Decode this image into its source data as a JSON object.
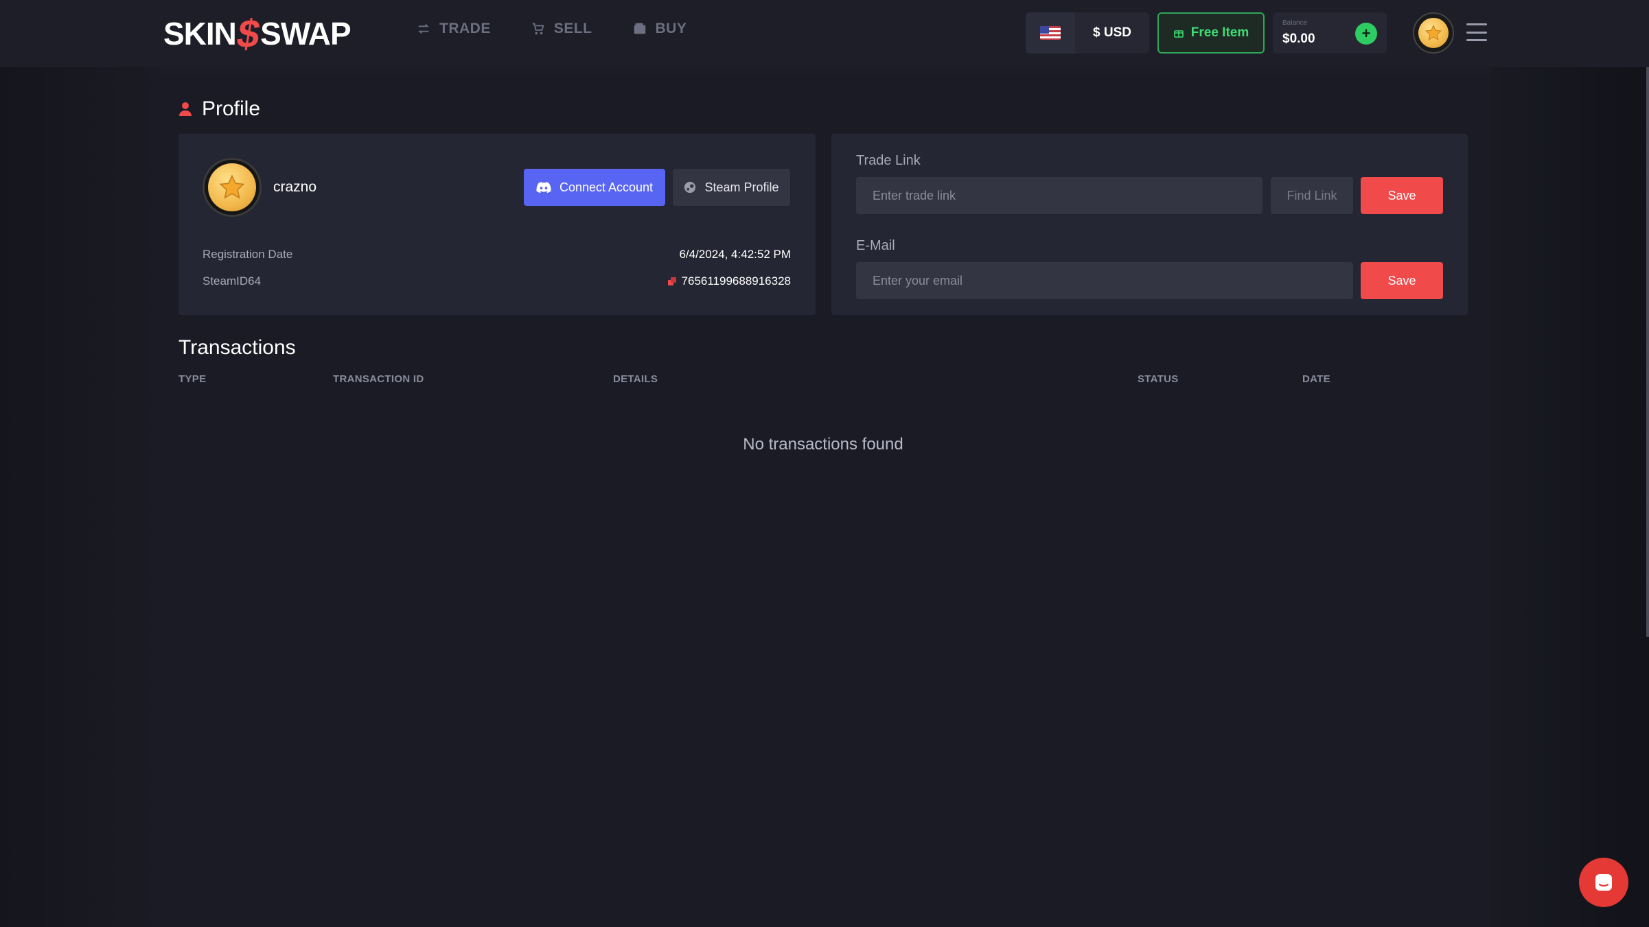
{
  "header": {
    "logo_left": "SKIN",
    "logo_mark": "$",
    "logo_right": "SWAP",
    "nav": [
      {
        "label": "TRADE",
        "icon": "trade-arrows-icon"
      },
      {
        "label": "SELL",
        "icon": "cart-icon"
      },
      {
        "label": "BUY",
        "icon": "wallet-icon"
      }
    ],
    "currency": "$ USD",
    "flag_icon": "us-flag-icon",
    "free_item": "Free Item",
    "balance_caption": "Balance",
    "balance_value": "$0.00",
    "add_balance": "+"
  },
  "profile": {
    "title": "Profile",
    "username": "crazno",
    "connect_label": "Connect Account",
    "steam_label": "Steam Profile",
    "registration_label": "Registration Date",
    "registration_value": "6/4/2024, 4:42:52 PM",
    "steamid_label": "SteamID64",
    "steamid_value": "76561199688916328"
  },
  "trade_link": {
    "label": "Trade Link",
    "placeholder": "Enter trade link",
    "find_label": "Find Link",
    "save_label": "Save"
  },
  "email": {
    "label": "E-Mail",
    "placeholder": "Enter your email",
    "save_label": "Save"
  },
  "transactions": {
    "title": "Transactions",
    "columns": [
      "TYPE",
      "TRANSACTION ID",
      "DETAILS",
      "STATUS",
      "DATE"
    ],
    "empty_text": "No transactions found"
  },
  "colors": {
    "accent": "#f04a4a",
    "discord": "#5865f2",
    "green": "#2ecc63",
    "background": "#1b1c25",
    "card": "#252633"
  }
}
